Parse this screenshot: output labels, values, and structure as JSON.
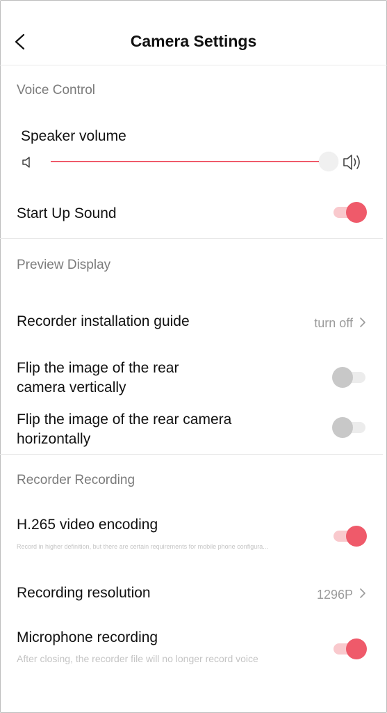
{
  "header": {
    "title": "Camera Settings"
  },
  "voice_control": {
    "section_title": "Voice Control",
    "speaker_volume_label": "Speaker volume",
    "speaker_volume_level": 1.0,
    "startup_sound_label": "Start Up Sound",
    "startup_sound_on": true
  },
  "preview_display": {
    "section_title": "Preview Display",
    "install_guide_label": "Recorder installation guide",
    "install_guide_value": "turn off",
    "flip_vertical_label_line1": "Flip the image of the rear",
    "flip_vertical_label_line2": "camera vertically",
    "flip_vertical_on": false,
    "flip_horizontal_label_line1": "Flip the image of the rear camera",
    "flip_horizontal_label_line2": "horizontally",
    "flip_horizontal_on": false
  },
  "recorder_recording": {
    "section_title": "Recorder Recording",
    "h265_label": "H.265 video encoding",
    "h265_desc": "Record in higher definition, but there are certain requirements for mobile phone configura...",
    "h265_on": true,
    "resolution_label": "Recording resolution",
    "resolution_value": "1296P",
    "mic_label": "Microphone recording",
    "mic_desc": "After closing, the recorder file will no longer record voice",
    "mic_on": true
  },
  "colors": {
    "accent": "#ef5a6a",
    "accent_light": "#f9c9cd",
    "toggle_off_knob": "#c8c8c8",
    "toggle_off_track": "#ececec",
    "section_title": "#7b7b7b",
    "secondary_text": "#9b9b9b"
  },
  "icons": [
    "back-chevron-icon",
    "speaker-low-icon",
    "speaker-high-icon",
    "chevron-right-icon"
  ]
}
